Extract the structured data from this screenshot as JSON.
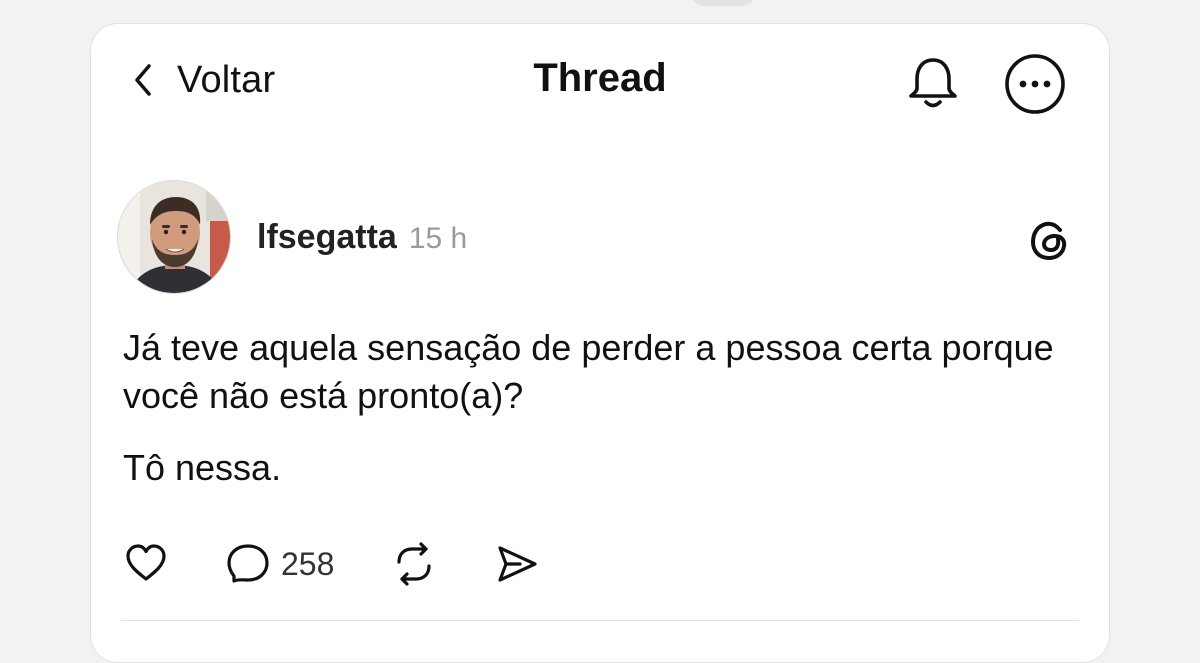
{
  "header": {
    "back_label": "Voltar",
    "title": "Thread",
    "bell_icon": "bell-icon",
    "more_icon": "more-options-icon"
  },
  "post": {
    "username": "lfsegatta",
    "time": "15 h",
    "paragraphs": [
      "Já teve aquela sensação de perder a pessoa certa porque você não está pronto(a)?",
      "Tô nessa."
    ],
    "actions": {
      "like_icon": "heart-icon",
      "reply_icon": "reply-bubble-icon",
      "reply_count": "258",
      "repost_icon": "repost-icon",
      "share_icon": "share-icon"
    }
  },
  "colors": {
    "background": "#f2f2f2",
    "card": "#ffffff",
    "text": "#111111",
    "muted": "#9a9a9a"
  }
}
